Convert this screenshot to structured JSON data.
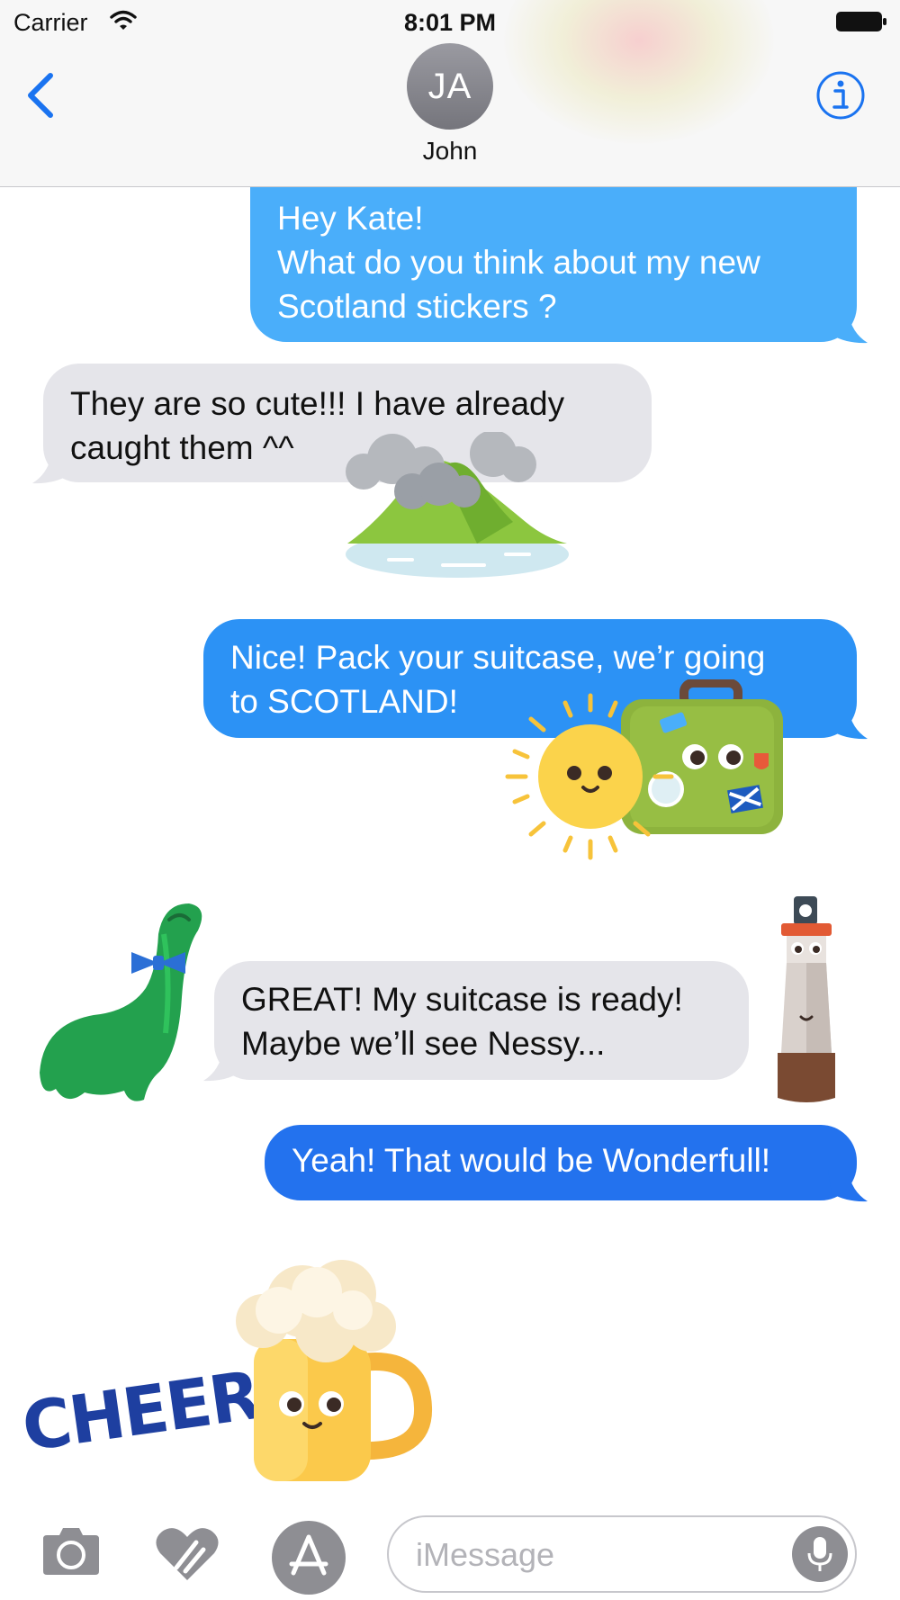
{
  "status_bar": {
    "carrier": "Carrier",
    "time": "8:01 PM"
  },
  "header": {
    "avatar_initials": "JA",
    "contact_name": "John"
  },
  "messages": [
    {
      "direction": "outgoing",
      "lines": [
        "Hey Kate!",
        "What do you think about my new",
        "Scotland stickers ?"
      ]
    },
    {
      "direction": "incoming",
      "lines": [
        "They are so cute!!! I have already",
        "caught them ^^"
      ]
    },
    {
      "direction": "outgoing",
      "lines": [
        "Nice! Pack your suitcase, we’r going",
        "to SCOTLAND!"
      ]
    },
    {
      "direction": "incoming",
      "lines": [
        "GREAT! My suitcase is ready!",
        "Maybe we’ll see Nessy..."
      ]
    },
    {
      "direction": "outgoing",
      "lines": [
        "Yeah! That would be Wonderfull!"
      ]
    }
  ],
  "stickers": {
    "island": "island-sticker",
    "sun_suitcase": "sun-suitcase-sticker",
    "nessie": "nessie-sticker",
    "lighthouse": "lighthouse-sticker",
    "cheers_text": "CHEERS!",
    "beer": "beer-mug-sticker"
  },
  "input": {
    "placeholder": "iMessage",
    "value": ""
  },
  "colors": {
    "bubble_out_1": "#4aaefa",
    "bubble_out_2": "#2c92f5",
    "bubble_out_3": "#2372ee",
    "bubble_in": "#e5e5ea",
    "tint": "#1a73f0"
  },
  "icons": {
    "back": "chevron-left-icon",
    "info": "info-icon",
    "camera": "camera-icon",
    "digital_touch": "heart-touch-icon",
    "appstore": "appstore-icon",
    "mic": "microphone-icon",
    "wifi": "wifi-icon",
    "battery": "battery-icon"
  }
}
